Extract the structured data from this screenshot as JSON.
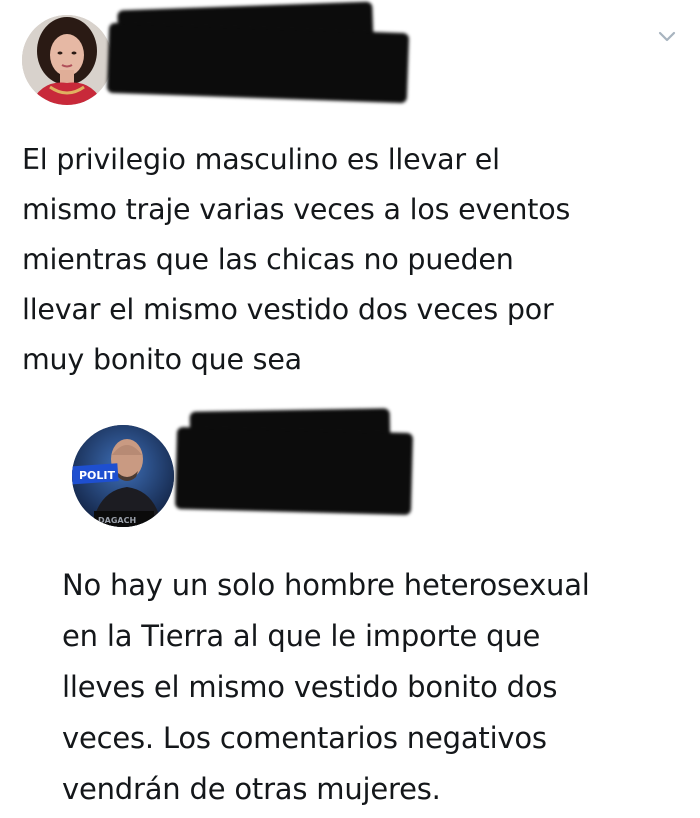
{
  "tweets": [
    {
      "avatar": "woman-avatar",
      "username_hidden": true,
      "menu_icon": "chevron-down-icon",
      "text": "El privilegio masculino es llevar el\nmismo traje varias veces a los eventos\nmientras que las chicas no pueden\nllevar el mismo vestido dos veces por\nmuy bonito que sea"
    },
    {
      "avatar": "man-avatar",
      "avatar_badge_text": "POLIT",
      "avatar_caption_text": "DAGACH",
      "username_hidden": true,
      "text": "No hay un solo hombre heterosexual\nen la Tierra al que le importe que\nlleves el mismo vestido bonito dos\nveces. Los comentarios negativos\nvendrán de otras mujeres."
    }
  ],
  "colors": {
    "background": "#ffffff",
    "text": "#14171a",
    "redaction": "#0c0c0c",
    "chevron": "#a8b4bf",
    "badge_bg": "#1e4fd0"
  }
}
